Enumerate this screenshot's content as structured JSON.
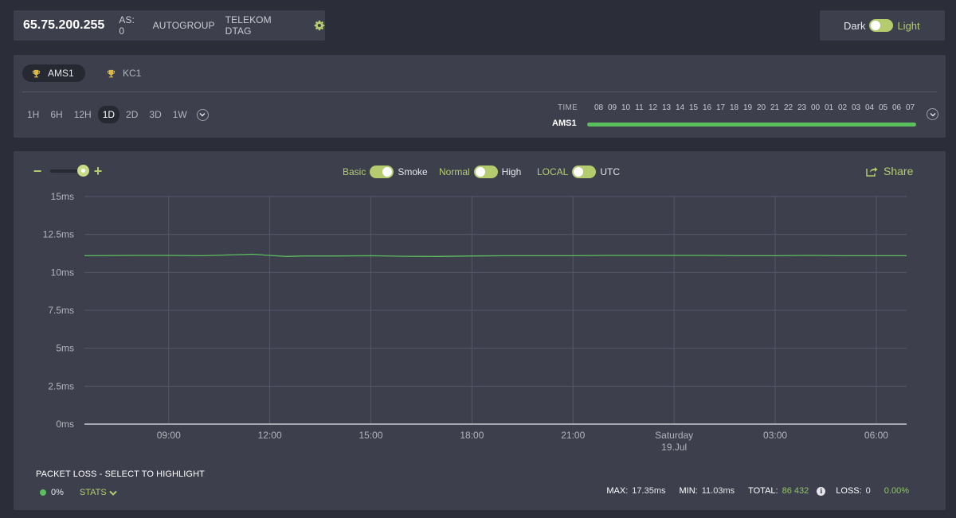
{
  "header": {
    "ip": "65.75.200.255",
    "as_label": "AS: 0",
    "group": "AUTOGROUP",
    "provider": "TELEKOM DTAG",
    "settings_icon": "gear-icon"
  },
  "theme": {
    "dark_label": "Dark",
    "light_label": "Light",
    "selected": "Light"
  },
  "nodes": {
    "tabs": [
      {
        "label": "AMS1",
        "icon": "trophy-icon",
        "active": true
      },
      {
        "label": "KC1",
        "icon": "trophy-icon",
        "active": false
      }
    ],
    "ranges": [
      "1H",
      "6H",
      "12H",
      "1D",
      "2D",
      "3D",
      "1W"
    ],
    "active_range": "1D",
    "time_label": "TIME",
    "hours": [
      "08",
      "09",
      "10",
      "11",
      "12",
      "13",
      "14",
      "15",
      "16",
      "17",
      "18",
      "19",
      "20",
      "21",
      "22",
      "23",
      "00",
      "01",
      "02",
      "03",
      "04",
      "05",
      "06",
      "07"
    ],
    "row_label": "AMS1",
    "colors": {
      "accent": "#b4cc6e",
      "ok": "#5cbf5e",
      "panel": "#3d3f4d",
      "background": "#2b2d38"
    }
  },
  "controls": {
    "zoom_minus": "−",
    "zoom_plus": "+",
    "zoom_level": 1.0,
    "basic": "Basic",
    "smoke": "Smoke",
    "normal": "Normal",
    "high": "High",
    "local": "LOCAL",
    "utc": "UTC",
    "share": "Share"
  },
  "chart_data": {
    "type": "line",
    "title": "",
    "xlabel": "",
    "ylabel": "",
    "ylim": [
      0,
      15
    ],
    "y_ticks": [
      "15ms",
      "12.5ms",
      "10ms",
      "7.5ms",
      "5ms",
      "2.5ms",
      "0ms"
    ],
    "y_tick_values": [
      15,
      12.5,
      10,
      7.5,
      5,
      2.5,
      0
    ],
    "x_ticks": [
      "09:00",
      "12:00",
      "15:00",
      "18:00",
      "21:00",
      "Saturday",
      "03:00",
      "06:00"
    ],
    "x_tick_sub": [
      "",
      "",
      "",
      "",
      "",
      "19.Jul",
      "",
      ""
    ],
    "x_tick_hours": [
      9,
      12,
      15,
      18,
      21,
      24,
      27,
      30
    ],
    "xlim_hours": [
      6.5,
      30.9
    ],
    "grid": true,
    "series": [
      {
        "color": "#5cbf5e",
        "x_hours": [
          6.5,
          8,
          9,
          10,
          10.8,
          11.5,
          12,
          12.5,
          13,
          14,
          15,
          16,
          17,
          18,
          19,
          20,
          21,
          22,
          23,
          24,
          25,
          26,
          27,
          28,
          29,
          30,
          30.9
        ],
        "values": [
          11.1,
          11.12,
          11.12,
          11.1,
          11.15,
          11.2,
          11.12,
          11.05,
          11.08,
          11.08,
          11.1,
          11.06,
          11.05,
          11.08,
          11.1,
          11.1,
          11.1,
          11.12,
          11.12,
          11.12,
          11.12,
          11.1,
          11.1,
          11.12,
          11.1,
          11.1,
          11.1
        ]
      }
    ]
  },
  "packet_loss": {
    "title": "PACKET LOSS - SELECT TO HIGHLIGHT",
    "value": "0%",
    "stats_label": "STATS"
  },
  "summary": {
    "max_label": "MAX:",
    "max": "17.35ms",
    "min_label": "MIN:",
    "min": "11.03ms",
    "total_label": "TOTAL:",
    "total": "86 432",
    "loss_label": "LOSS:",
    "loss": "0",
    "loss_pct": "0.00%"
  }
}
